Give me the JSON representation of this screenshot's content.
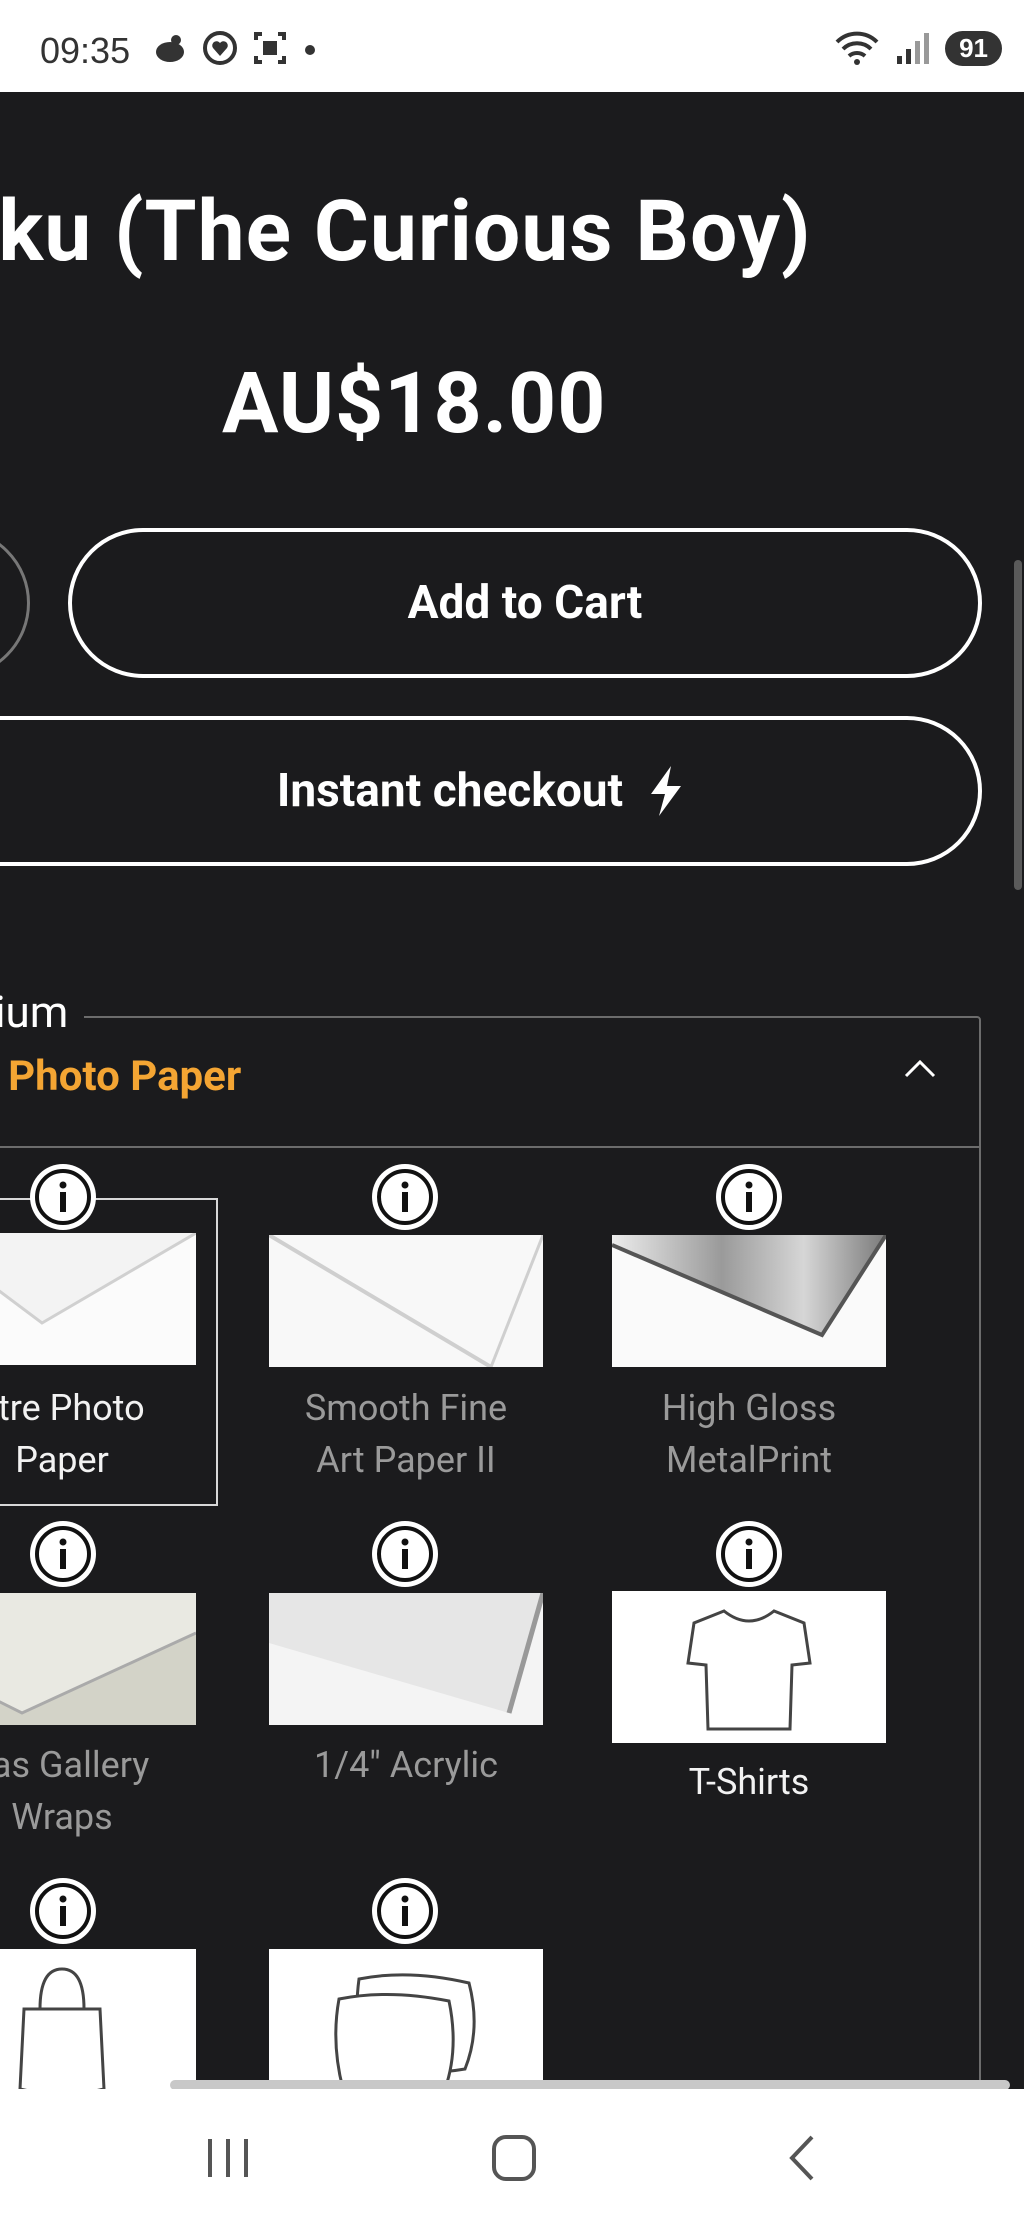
{
  "status_bar": {
    "time": "09:35",
    "battery": "91",
    "left_icons": [
      "notification-icon",
      "heart-icon",
      "screenshot-icon",
      "dot-icon"
    ],
    "right_icons": [
      "wifi-icon",
      "signal-icon"
    ]
  },
  "product": {
    "title": "eku (The Curious Boy)",
    "price": "AU$18.00"
  },
  "buttons": {
    "add_to_cart": "Add to Cart",
    "instant_checkout": "Instant checkout"
  },
  "medium": {
    "legend": "dium",
    "selected": "re Photo Paper",
    "options": [
      {
        "label_l1": "stre Photo",
        "label_l2": "Paper",
        "selected": true
      },
      {
        "label_l1": "Smooth Fine",
        "label_l2": "Art Paper II",
        "selected": false
      },
      {
        "label_l1": "High Gloss",
        "label_l2": "MetalPrint",
        "selected": false
      },
      {
        "label_l1": "vas Gallery",
        "label_l2": "Wraps",
        "selected": false
      },
      {
        "label_l1": "1/4\" Acrylic",
        "label_l2": "",
        "selected": false
      },
      {
        "label_l1": "T-Shirts",
        "label_l2": "",
        "selected": false
      },
      {
        "label_l1": "",
        "label_l2": "",
        "selected": false
      },
      {
        "label_l1": "",
        "label_l2": "",
        "selected": false
      }
    ]
  },
  "colors": {
    "background": "#1b1b1d",
    "accent": "#f4a533",
    "text": "#ffffff"
  }
}
